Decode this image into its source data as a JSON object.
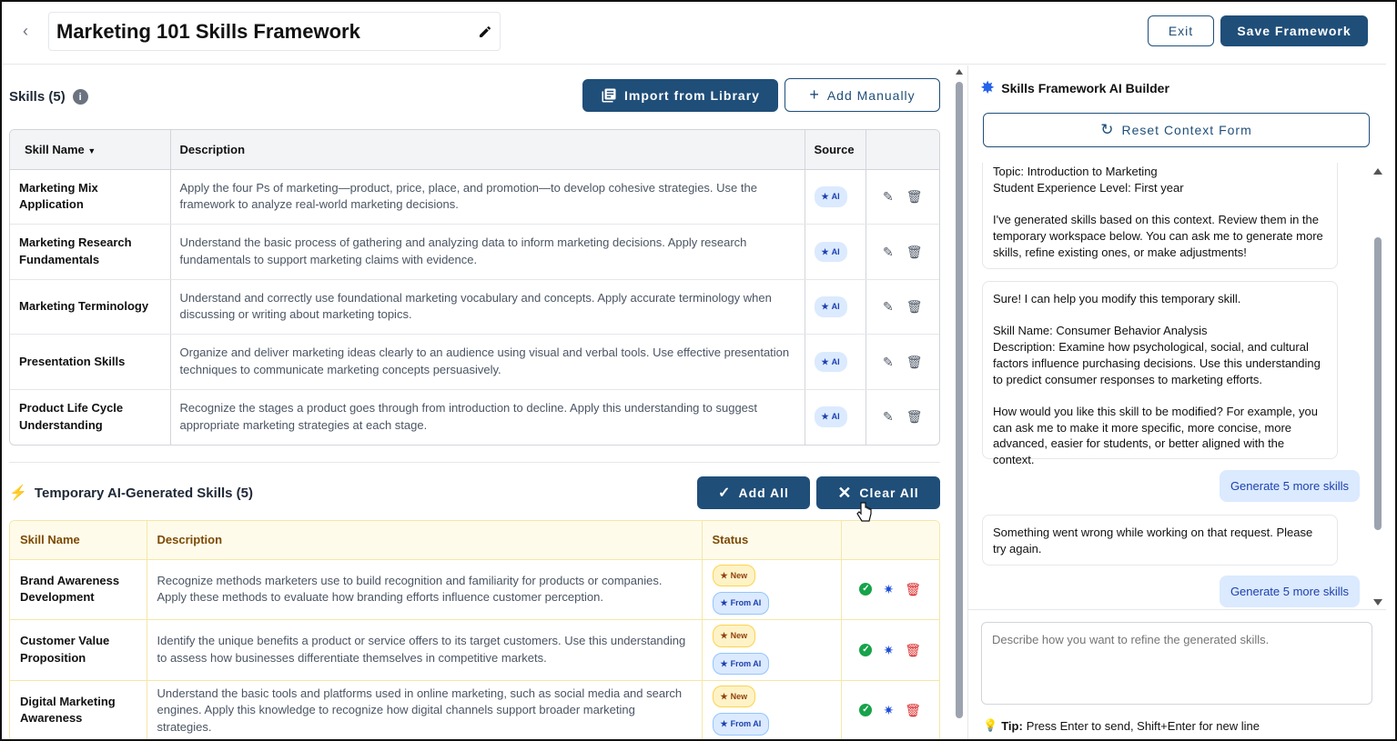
{
  "header": {
    "title": "Marketing 101 Skills Framework",
    "exit_label": "Exit",
    "save_label": "Save Framework"
  },
  "skills": {
    "heading": "Skills (5)",
    "import_label": "Import from Library",
    "add_manual_label": "Add Manually",
    "columns": [
      "Skill Name",
      "Description",
      "Source"
    ],
    "rows": [
      {
        "name": "Marketing Mix Application",
        "description": "Apply the four Ps of marketing—product, price, place, and promotion—to develop cohesive strategies. Use the framework to analyze real-world marketing decisions.",
        "source": "AI"
      },
      {
        "name": "Marketing Research Fundamentals",
        "description": "Understand the basic process of gathering and analyzing data to inform marketing decisions. Apply research fundamentals to support marketing claims with evidence.",
        "source": "AI"
      },
      {
        "name": "Marketing Terminology",
        "description": "Understand and correctly use foundational marketing vocabulary and concepts. Apply accurate terminology when discussing or writing about marketing topics.",
        "source": "AI"
      },
      {
        "name": "Presentation Skills",
        "description": "Organize and deliver marketing ideas clearly to an audience using visual and verbal tools. Use effective presentation techniques to communicate marketing concepts persuasively.",
        "source": "AI"
      },
      {
        "name": "Product Life Cycle Understanding",
        "description": "Recognize the stages a product goes through from introduction to decline. Apply this understanding to suggest appropriate marketing strategies at each stage.",
        "source": "AI"
      }
    ]
  },
  "temp": {
    "heading": "Temporary AI-Generated Skills (5)",
    "add_all_label": "Add All",
    "clear_all_label": "Clear All",
    "columns": [
      "Skill Name",
      "Description",
      "Status"
    ],
    "badge_new": "New",
    "badge_fromai": "From AI",
    "rows": [
      {
        "name": "Brand Awareness Development",
        "description": "Recognize methods marketers use to build recognition and familiarity for products or companies. Apply these methods to evaluate how branding efforts influence customer perception."
      },
      {
        "name": "Customer Value Proposition",
        "description": "Identify the unique benefits a product or service offers to its target customers. Use this understanding to assess how businesses differentiate themselves in competitive markets."
      },
      {
        "name": "Digital Marketing Awareness",
        "description": "Understand the basic tools and platforms used in online marketing, such as social media and search engines. Apply this knowledge to recognize how digital channels support broader marketing strategies."
      }
    ]
  },
  "ai_panel": {
    "title": "Skills Framework AI Builder",
    "reset_label": "Reset Context Form",
    "messages": [
      {
        "role": "ai",
        "text": "Topic: Introduction to Marketing\nStudent Experience Level: First year\n\nI've generated skills based on this context. Review them in the temporary workspace below. You can ask me to generate more skills, refine existing ones, or make adjustments!"
      },
      {
        "role": "ai",
        "text": "Sure! I can help you modify this temporary skill.\n\nSkill Name: Consumer Behavior Analysis\nDescription: Examine how psychological, social, and cultural factors influence purchasing decisions. Use this understanding to predict consumer responses to marketing efforts.\n\nHow would you like this skill to be modified? For example, you can ask me to make it more specific, more concise, more advanced, easier for students, or better aligned with the context."
      },
      {
        "role": "user",
        "text": "Generate 5 more skills"
      },
      {
        "role": "ai",
        "text": "Something went wrong while working on that request. Please try again."
      },
      {
        "role": "user",
        "text": "Generate 5 more skills"
      }
    ],
    "input_placeholder": "Describe how you want to refine the generated skills.",
    "tip_label": "Tip:",
    "tip_text": "Press Enter to send, Shift+Enter for new line"
  },
  "colors": {
    "primary": "#1f4e79",
    "accent_blue": "#2563eb",
    "warn": "#f59e0b",
    "danger": "#dc2626",
    "success": "#16a34a"
  }
}
